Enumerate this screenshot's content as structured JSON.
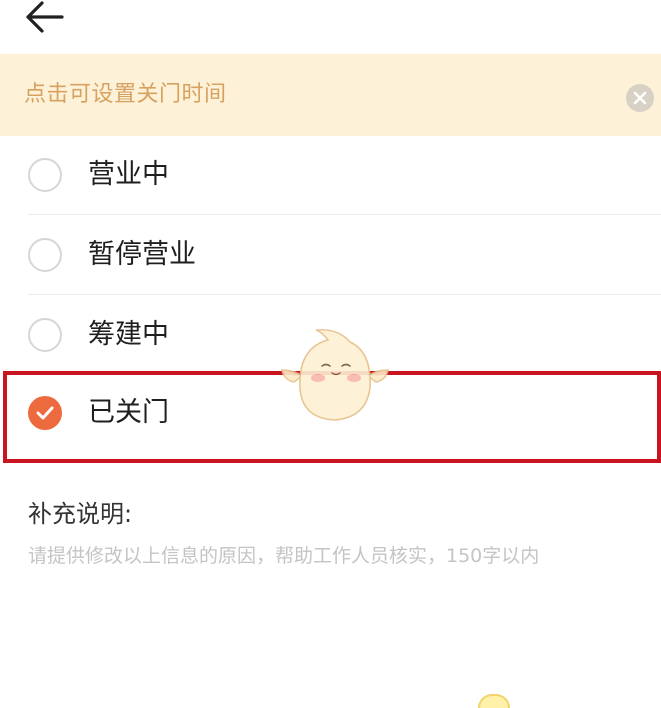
{
  "header": {
    "back_icon": "arrow-left-icon"
  },
  "notice": {
    "text": "点击可设置关门时间",
    "close_icon": "close-circle-icon"
  },
  "options": [
    {
      "label": "营业中",
      "checked": false
    },
    {
      "label": "暂停营业",
      "checked": false
    },
    {
      "label": "筹建中",
      "checked": false
    },
    {
      "label": "已关门",
      "checked": true
    }
  ],
  "note": {
    "title": "补充说明:",
    "placeholder": "请提供修改以上信息的原因，帮助工作人员核实，150字以内"
  },
  "colors": {
    "accent": "#ec6a3d",
    "notice_bg": "#fdf1d8",
    "notice_text": "#d7a260",
    "highlight": "#c8141e"
  }
}
